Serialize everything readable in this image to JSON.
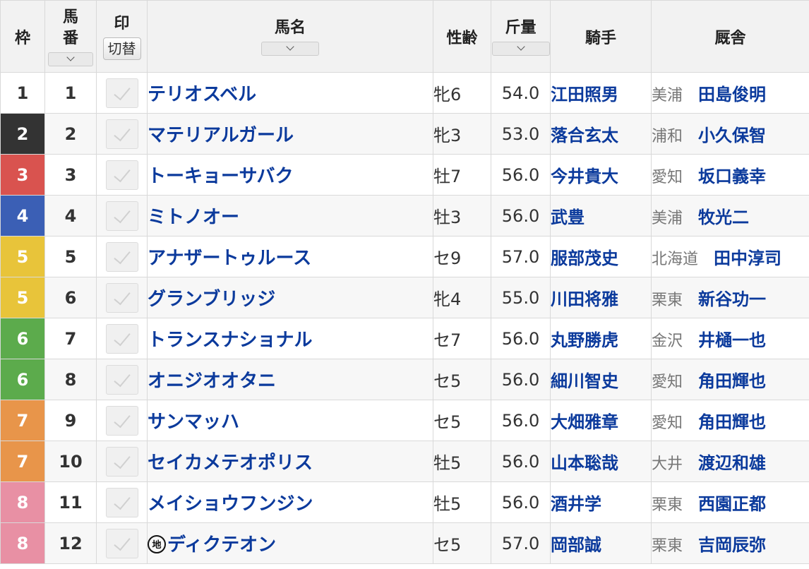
{
  "header": {
    "waku": "枠",
    "umaban": [
      "馬",
      "番"
    ],
    "mark": "印",
    "mark_toggle": "切替",
    "horse": "馬名",
    "sex_age": "性齢",
    "weight": "斤量",
    "jockey": "騎手",
    "stable": "厩舎"
  },
  "colors": {
    "waku": {
      "1": {
        "bg": "#ffffff",
        "fg": "#333333"
      },
      "2": {
        "bg": "#333333",
        "fg": "#ffffff"
      },
      "3": {
        "bg": "#d9534f",
        "fg": "#ffffff"
      },
      "4": {
        "bg": "#3b5fb5",
        "fg": "#ffffff"
      },
      "5": {
        "bg": "#e8c43a",
        "fg": "#ffffff"
      },
      "6": {
        "bg": "#5cab4c",
        "fg": "#ffffff"
      },
      "7": {
        "bg": "#e8954a",
        "fg": "#ffffff"
      },
      "8": {
        "bg": "#e890a4",
        "fg": "#ffffff"
      }
    },
    "link": "#0b3a9c"
  },
  "entries": [
    {
      "waku": "1",
      "num": "1",
      "horse": "テリオスベル",
      "chiho": false,
      "sex_age": "牝6",
      "weight": "54.0",
      "jockey": "江田照男",
      "region": "美浦",
      "trainer": "田島俊明"
    },
    {
      "waku": "2",
      "num": "2",
      "horse": "マテリアルガール",
      "chiho": false,
      "sex_age": "牝3",
      "weight": "53.0",
      "jockey": "落合玄太",
      "region": "浦和",
      "trainer": "小久保智"
    },
    {
      "waku": "3",
      "num": "3",
      "horse": "トーキョーサバク",
      "chiho": false,
      "sex_age": "牡7",
      "weight": "56.0",
      "jockey": "今井貴大",
      "region": "愛知",
      "trainer": "坂口義幸"
    },
    {
      "waku": "4",
      "num": "4",
      "horse": "ミトノオー",
      "chiho": false,
      "sex_age": "牡3",
      "weight": "56.0",
      "jockey": "武豊",
      "region": "美浦",
      "trainer": "牧光二"
    },
    {
      "waku": "5",
      "num": "5",
      "horse": "アナザートゥルース",
      "chiho": false,
      "sex_age": "セ9",
      "weight": "57.0",
      "jockey": "服部茂史",
      "region": "北海道",
      "trainer": "田中淳司"
    },
    {
      "waku": "5",
      "num": "6",
      "horse": "グランブリッジ",
      "chiho": false,
      "sex_age": "牝4",
      "weight": "55.0",
      "jockey": "川田将雅",
      "region": "栗東",
      "trainer": "新谷功一"
    },
    {
      "waku": "6",
      "num": "7",
      "horse": "トランスナショナル",
      "chiho": false,
      "sex_age": "セ7",
      "weight": "56.0",
      "jockey": "丸野勝虎",
      "region": "金沢",
      "trainer": "井樋一也"
    },
    {
      "waku": "6",
      "num": "8",
      "horse": "オニジオオタニ",
      "chiho": false,
      "sex_age": "セ5",
      "weight": "56.0",
      "jockey": "細川智史",
      "region": "愛知",
      "trainer": "角田輝也"
    },
    {
      "waku": "7",
      "num": "9",
      "horse": "サンマッハ",
      "chiho": false,
      "sex_age": "セ5",
      "weight": "56.0",
      "jockey": "大畑雅章",
      "region": "愛知",
      "trainer": "角田輝也"
    },
    {
      "waku": "7",
      "num": "10",
      "horse": "セイカメテオポリス",
      "chiho": false,
      "sex_age": "牡5",
      "weight": "56.0",
      "jockey": "山本聡哉",
      "region": "大井",
      "trainer": "渡辺和雄"
    },
    {
      "waku": "8",
      "num": "11",
      "horse": "メイショウフンジン",
      "chiho": false,
      "sex_age": "牡5",
      "weight": "56.0",
      "jockey": "酒井学",
      "region": "栗東",
      "trainer": "西園正都"
    },
    {
      "waku": "8",
      "num": "12",
      "horse": "ディクテオン",
      "chiho": true,
      "chiho_label": "地",
      "sex_age": "セ5",
      "weight": "57.0",
      "jockey": "岡部誠",
      "region": "栗東",
      "trainer": "吉岡辰弥"
    }
  ]
}
